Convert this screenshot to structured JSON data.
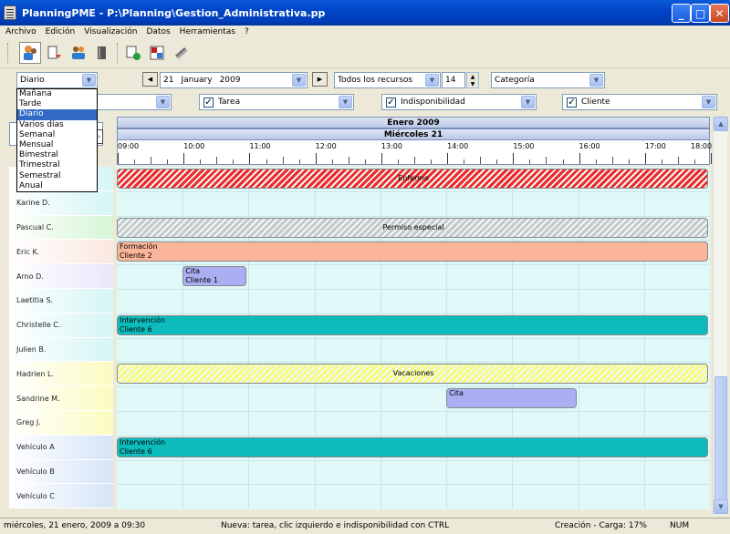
{
  "window": {
    "title": "PlanningPME - P:\\Planning\\Gestion_Administrativa.pp"
  },
  "menu": [
    "Archivo",
    "Edición",
    "Visualización",
    "Datos",
    "Herramientas",
    "?"
  ],
  "toolbar": {
    "icons": [
      "resources-icon",
      "tasks-icon",
      "users-icon",
      "book-icon",
      "export-icon",
      "grid-icon",
      "link-icon"
    ]
  },
  "filters": {
    "view": "Diario",
    "date_day": "21",
    "date_month": "January",
    "date_year": "2009",
    "resources": "Todos los recursos",
    "days": "14",
    "category": "Categoría",
    "row2_combo1": "",
    "tarea": "Tarea",
    "indisponibilidad": "Indisponibilidad",
    "cliente": "Cliente"
  },
  "view_options": [
    "Mañana",
    "Tarde",
    "Diario",
    "Varios días",
    "Semanal",
    "Mensual",
    "Bimestral",
    "Trimestral",
    "Semestral",
    "Anual"
  ],
  "calendar": {
    "month": "Enero 2009",
    "day": "Miércoles 21",
    "hours": [
      "09:00",
      "10:00",
      "11:00",
      "12:00",
      "13:00",
      "14:00",
      "15:00",
      "16:00",
      "17:00",
      "18:00"
    ]
  },
  "resources": [
    "",
    "Karine D.",
    "Pascual C.",
    "Eric K.",
    "Arno D.",
    "Laetitia S.",
    "Christelle C.",
    "Julien B.",
    "Hadrien L.",
    "Sandrine M.",
    "Greg J.",
    "Vehículo A",
    "Vehículo B",
    "Vehículo C"
  ],
  "events": [
    {
      "label1": "Enfermo",
      "label2": "",
      "color": "#ee2a2a"
    },
    {
      "label1": "Permiso especial",
      "label2": "",
      "color": "#c8c8c8"
    },
    {
      "label1": "Formación",
      "label2": "Cliente 2",
      "color": "#fbb59a"
    },
    {
      "label1": "Cita",
      "label2": "Cliente 1",
      "color": "#aaaef2"
    },
    {
      "label1": "Intervención",
      "label2": "Cliente 6",
      "color": "#0cbcbc"
    },
    {
      "label1": "Vacaciones",
      "label2": "",
      "color": "#fafa7a"
    },
    {
      "label1": "Cita",
      "label2": "",
      "color": "#aaaef2"
    },
    {
      "label1": "Intervención",
      "label2": "Cliente 6",
      "color": "#0cbcbc"
    }
  ],
  "status": {
    "datetime": "miércoles, 21 enero, 2009 a 09:30",
    "hint": "Nueva: tarea, clic izquierdo e indisponibilidad con CTRL",
    "load": "Creación - Carga: 17%",
    "num": "NUM"
  }
}
